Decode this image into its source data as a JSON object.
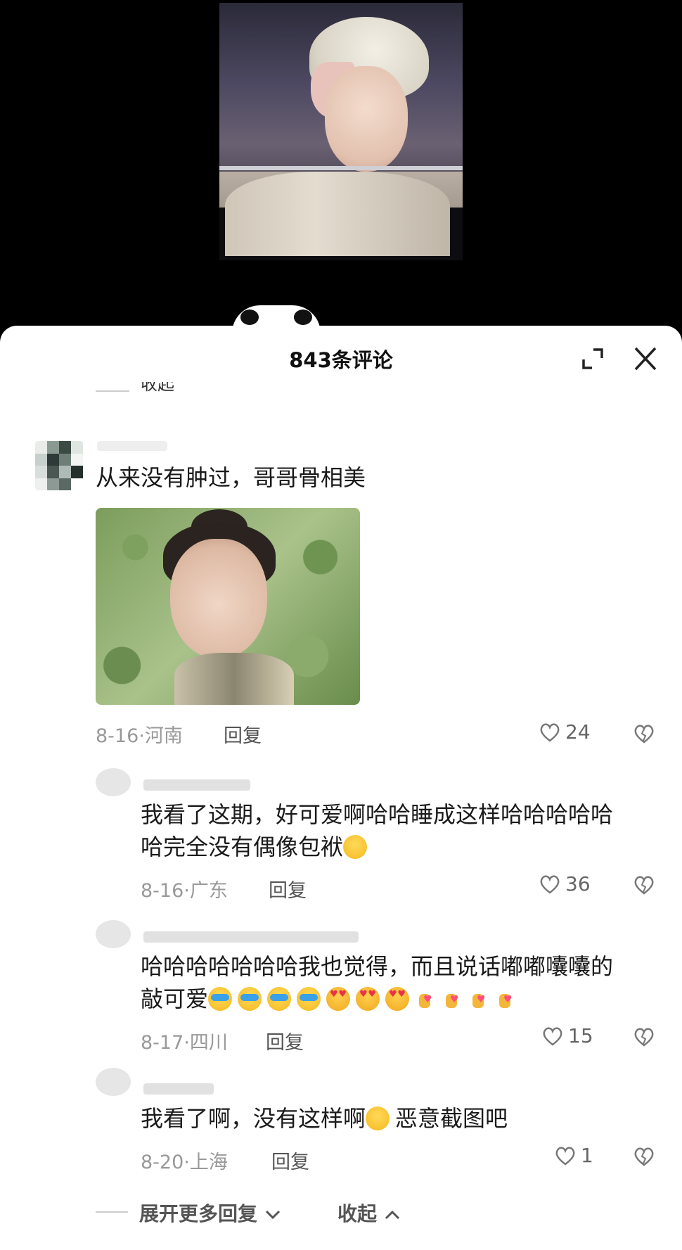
{
  "sheet": {
    "title": "843条评论",
    "collapse_stub": "收起 ^"
  },
  "comments": [
    {
      "text": "从来没有肿过，哥哥骨相美",
      "date": "8-16",
      "location": "河南",
      "reply_label": "回复",
      "likes": "24"
    }
  ],
  "replies": [
    {
      "text_line1": "我看了这期，好可爱啊哈哈睡成这样哈哈哈哈哈",
      "text_line2": "哈完全没有偶像包袱",
      "date": "8-16",
      "location": "广东",
      "reply_label": "回复",
      "likes": "36"
    },
    {
      "text_line1": "哈哈哈哈哈哈哈我也觉得，而且说话嘟嘟囔囔的",
      "text_line2": "敲可爱",
      "date": "8-17",
      "location": "四川",
      "reply_label": "回复",
      "likes": "15"
    },
    {
      "text_line1_a": "我看了啊，没有这样啊",
      "text_line1_b": "恶意截图吧",
      "date": "8-20",
      "location": "上海",
      "reply_label": "回复",
      "likes": "1"
    }
  ],
  "footer": {
    "more_label": "展开更多回复",
    "collapse_label": "收起"
  },
  "icons": {
    "expand": "expand-icon",
    "close": "close-icon",
    "like": "heart-outline-icon",
    "dislike": "broken-heart-icon"
  }
}
